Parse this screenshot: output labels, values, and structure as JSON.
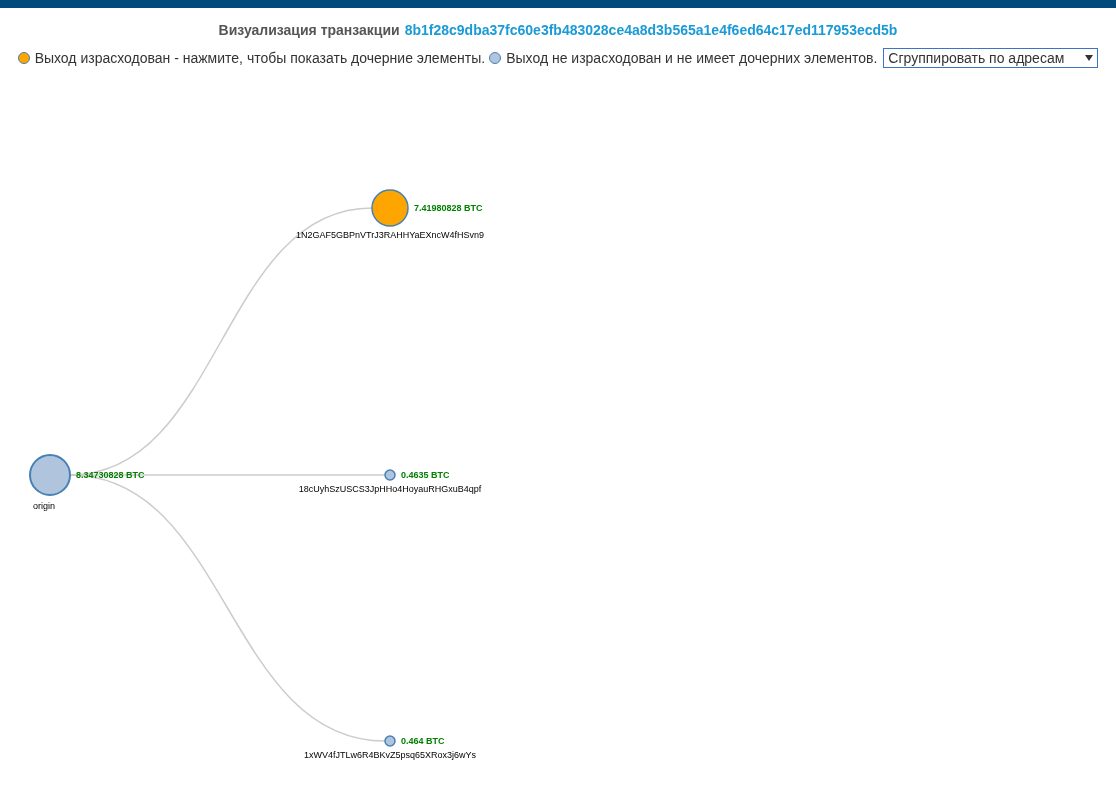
{
  "header": {
    "title": "Визуализация транзакции",
    "txid": "8b1f28c9dba37fc60e3fb483028ce4a8d3b565a1e4f6ed64c17ed117953ecd5b"
  },
  "legend": [
    {
      "text": "Выход израсходован - нажмите, чтобы показать дочерние элементы.",
      "color": "#ffa500"
    },
    {
      "text": "Выход не израсходован и не имеет дочерних элементов.",
      "color": "#b0c4de"
    }
  ],
  "group_select": {
    "value": "Сгруппировать по адресам"
  },
  "tree": {
    "label": "origin",
    "amount": "8.34730828 BTC",
    "children": [
      {
        "label": "1N2GAF5GBPnVTrJ3RAHHYaEXncW4fHSvn9",
        "amount": "7.41980828 BTC",
        "spent": true
      },
      {
        "label": "18cUyhSzUSCS3JpHHo4HoyauRHGxuB4qpf",
        "amount": "0.4635 BTC",
        "spent": false
      },
      {
        "label": "1xWV4fJTLw6R4BKvZ5psq65XRox3j6wYs",
        "amount": "0.464 BTC",
        "spent": false
      }
    ]
  }
}
